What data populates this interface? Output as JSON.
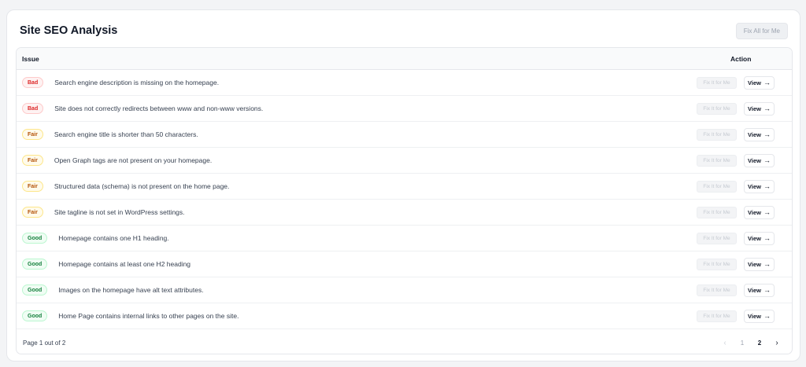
{
  "header": {
    "title": "Site SEO Analysis",
    "fix_all_label": "Fix All for Me"
  },
  "table": {
    "columns": [
      "Issue",
      "Action"
    ],
    "rows": [
      {
        "status": "Bad",
        "issue": "Search engine description is missing on the homepage.",
        "fix_label": "Fix It for Me",
        "view_label": "View"
      },
      {
        "status": "Bad",
        "issue": "Site does not correctly redirects between www and non-www versions.",
        "fix_label": "Fix It for Me",
        "view_label": "View"
      },
      {
        "status": "Fair",
        "issue": "Search engine title is shorter than 50 characters.",
        "fix_label": "Fix It for Me",
        "view_label": "View"
      },
      {
        "status": "Fair",
        "issue": "Open Graph tags are not present on your homepage.",
        "fix_label": "Fix It for Me",
        "view_label": "View"
      },
      {
        "status": "Fair",
        "issue": "Structured data (schema) is not present on the home page.",
        "fix_label": "Fix It for Me",
        "view_label": "View"
      },
      {
        "status": "Fair",
        "issue": "Site tagline is not set in WordPress settings.",
        "fix_label": "Fix It for Me",
        "view_label": "View"
      },
      {
        "status": "Good",
        "issue": "Homepage contains one H1 heading.",
        "fix_label": "Fix It for Me",
        "view_label": "View"
      },
      {
        "status": "Good",
        "issue": "Homepage contains at least one H2 heading",
        "fix_label": "Fix It for Me",
        "view_label": "View"
      },
      {
        "status": "Good",
        "issue": "Images on the homepage have alt text attributes.",
        "fix_label": "Fix It for Me",
        "view_label": "View"
      },
      {
        "status": "Good",
        "issue": "Home Page contains internal links to other pages on the site.",
        "fix_label": "Fix It for Me",
        "view_label": "View"
      }
    ]
  },
  "pagination": {
    "info": "Page 1 out of 2",
    "pages": [
      "1",
      "2"
    ],
    "current": "2",
    "prev_icon": "chevron-left-icon",
    "next_icon": "chevron-right-icon"
  },
  "icons": {
    "view_arrow": "arrow-right-icon"
  },
  "colors": {
    "bad": "#dc2626",
    "fair": "#b45309",
    "good": "#15803d"
  }
}
